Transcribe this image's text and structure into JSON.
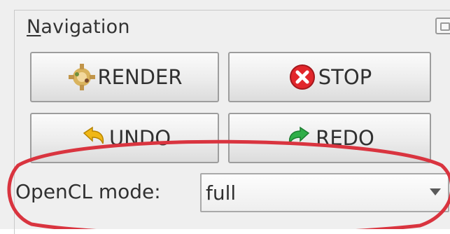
{
  "panel": {
    "title_prefix": "N",
    "title_rest": "avigation"
  },
  "buttons": {
    "render": {
      "label": "RENDER",
      "icon": "render-gear-icon"
    },
    "stop": {
      "label": "STOP",
      "icon": "stop-icon"
    },
    "undo": {
      "label": "UNDO",
      "icon": "undo-icon"
    },
    "redo": {
      "label": "REDO",
      "icon": "redo-icon"
    }
  },
  "opencl": {
    "label": "OpenCL mode:",
    "value": "full"
  },
  "colors": {
    "highlight": "#d9343f",
    "stop_icon": "#e2262b",
    "undo_icon": "#f0b716",
    "redo_icon": "#2fae48"
  }
}
